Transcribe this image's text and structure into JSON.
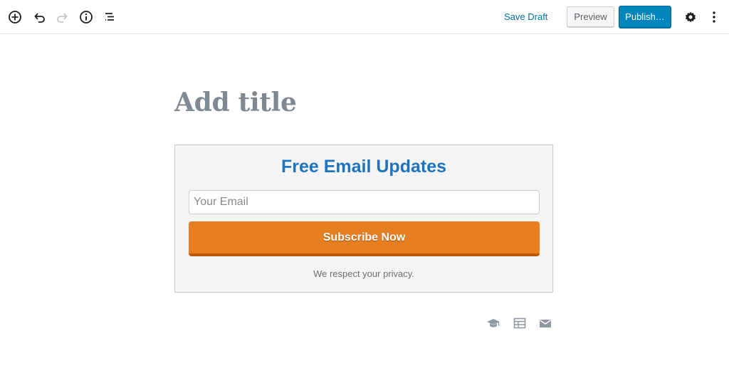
{
  "toolbar": {
    "icons": {
      "add": "add-block-icon",
      "undo": "undo-icon",
      "redo": "redo-icon",
      "info": "info-icon",
      "outline": "block-navigation-icon",
      "settings": "gear-icon",
      "more": "more-vertical-icon"
    },
    "save_draft_label": "Save Draft",
    "preview_label": "Preview",
    "publish_label": "Publish…"
  },
  "editor": {
    "title_placeholder": "Add title"
  },
  "email_widget": {
    "heading": "Free Email Updates",
    "email_placeholder": "Your Email",
    "email_value": "",
    "subscribe_label": "Subscribe Now",
    "privacy_text": "We respect your privacy."
  },
  "inserter_shortcuts": [
    {
      "icon": "graduation-cap-icon"
    },
    {
      "icon": "table-icon"
    },
    {
      "icon": "email-icon"
    }
  ],
  "colors": {
    "accent_link": "#0073aa",
    "publish_bg": "#0085ba",
    "heading_blue": "#1e73be",
    "subscribe_orange": "#e67e22",
    "title_gray": "#7e8993"
  }
}
